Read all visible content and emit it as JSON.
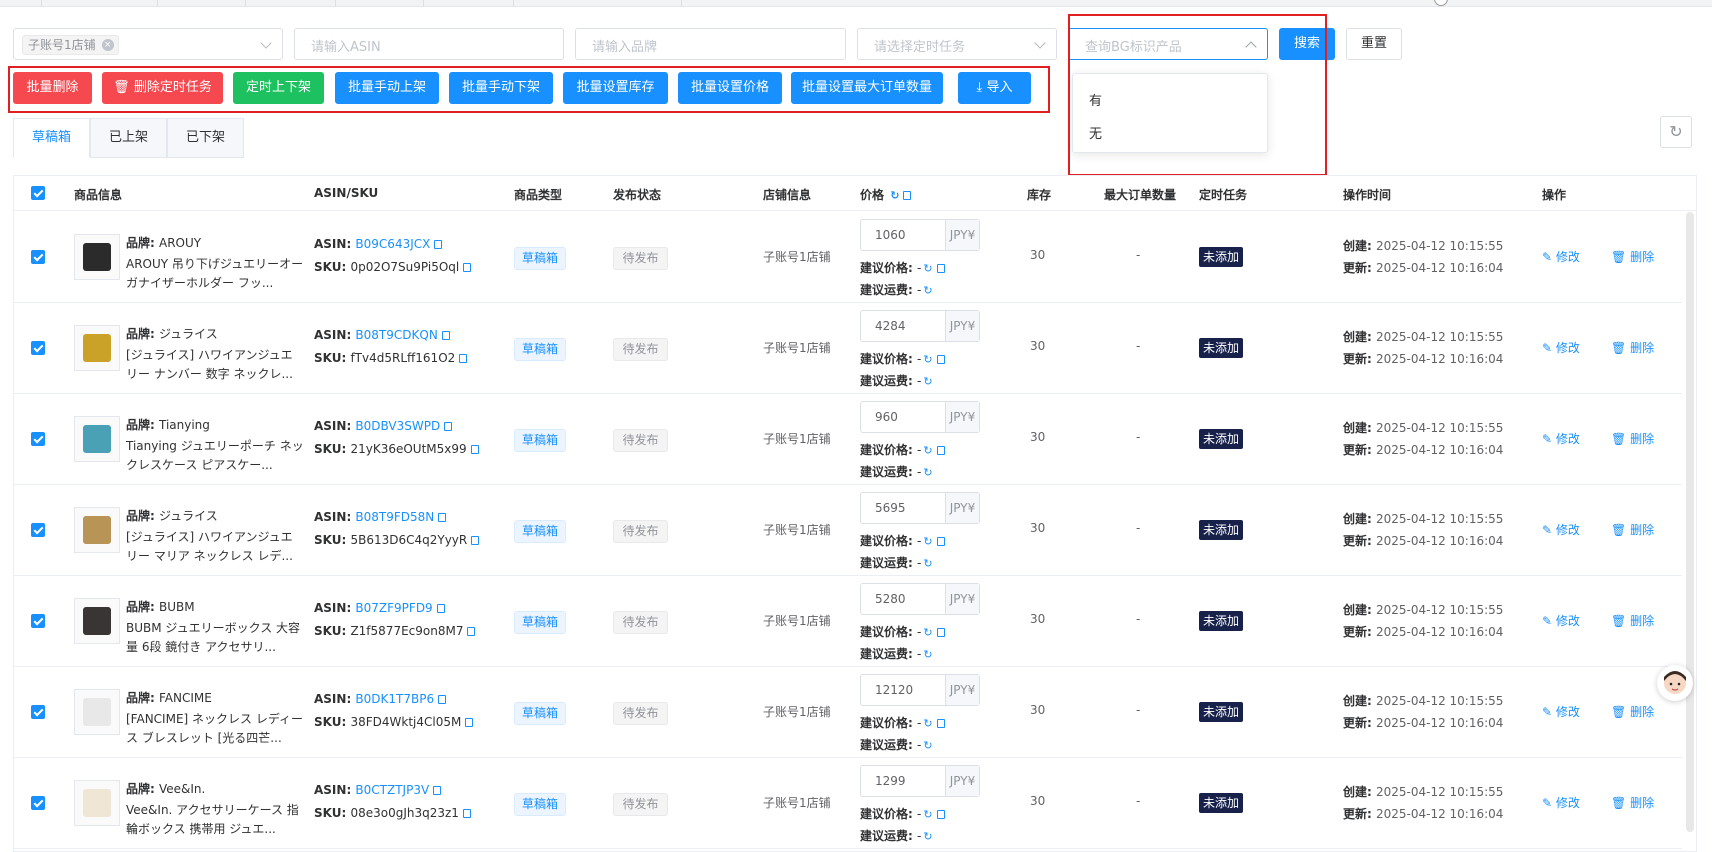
{
  "filters": {
    "store_tag": "子账号1店铺",
    "asin_placeholder": "请输入ASIN",
    "brand_placeholder": "请输入品牌",
    "task_placeholder": "请选择定时任务",
    "bg_placeholder": "查询BG标识产品",
    "search_label": "搜索",
    "reset_label": "重置"
  },
  "dropdown": {
    "options": [
      "有",
      "无"
    ]
  },
  "actions": {
    "batch_delete": "批量删除",
    "delete_timer": "删除定时任务",
    "timed_shelf": "定时上下架",
    "batch_list": "批量手动上架",
    "batch_delist": "批量手动下架",
    "batch_stock": "批量设置库存",
    "batch_price": "批量设置价格",
    "batch_max_order": "批量设置最大订单数量",
    "import": "导入"
  },
  "tabs": [
    "草稿箱",
    "已上架",
    "已下架"
  ],
  "columns": {
    "product": "商品信息",
    "asin_sku": "ASIN/SKU",
    "type": "商品类型",
    "status": "发布状态",
    "store": "店铺信息",
    "price": "价格",
    "stock": "库存",
    "max_order": "最大订单数量",
    "schedule": "定时任务",
    "op_time": "操作时间",
    "ops": "操作"
  },
  "labels": {
    "brand": "品牌: ",
    "asin": "ASIN: ",
    "sku": "SKU: ",
    "suggest_price": "建议价格: ",
    "suggest_ship": "建议运费: ",
    "created": "创建: ",
    "updated": "更新: ",
    "edit": "修改",
    "delete": "删除",
    "currency": "JPY¥",
    "dash": "-"
  },
  "rows": [
    {
      "brand": "AROUY",
      "name": "AROUY 吊り下げジュエリーオーガナイザーホルダー フッ...",
      "asin": "B09C643JCX",
      "sku": "0p02O7Su9Pi5Oql",
      "type": "草稿箱",
      "status": "待发布",
      "store": "子账号1店铺",
      "price": "1060",
      "stock": "30",
      "max_order": "-",
      "schedule": "未添加",
      "created": "2025-04-12 10:15:55",
      "updated": "2025-04-12 10:16:04"
    },
    {
      "brand": "ジュライス",
      "name": "[ジュライス] ハワイアンジュエリー ナンバー 数字 ネックレ...",
      "asin": "B08T9CDKQN",
      "sku": "fTv4d5RLff161O2",
      "type": "草稿箱",
      "status": "待发布",
      "store": "子账号1店铺",
      "price": "4284",
      "stock": "30",
      "max_order": "-",
      "schedule": "未添加",
      "created": "2025-04-12 10:15:55",
      "updated": "2025-04-12 10:16:04"
    },
    {
      "brand": "Tianying",
      "name": "Tianying ジュエリーポーチ ネックレスケース ピアスケー...",
      "asin": "B0DBV3SWPD",
      "sku": "21yK36eOUtM5x99",
      "type": "草稿箱",
      "status": "待发布",
      "store": "子账号1店铺",
      "price": "960",
      "stock": "30",
      "max_order": "-",
      "schedule": "未添加",
      "created": "2025-04-12 10:15:55",
      "updated": "2025-04-12 10:16:04"
    },
    {
      "brand": "ジュライス",
      "name": "[ジュライス] ハワイアンジュエリー マリア ネックレス レデ...",
      "asin": "B08T9FD58N",
      "sku": "5B613D6C4q2YyyR",
      "type": "草稿箱",
      "status": "待发布",
      "store": "子账号1店铺",
      "price": "5695",
      "stock": "30",
      "max_order": "-",
      "schedule": "未添加",
      "created": "2025-04-12 10:15:55",
      "updated": "2025-04-12 10:16:04"
    },
    {
      "brand": "BUBM",
      "name": "BUBM ジュエリーボックス 大容量 6段 鏡付き アクセサリ...",
      "asin": "B07ZF9PFD9",
      "sku": "Z1f5877Ec9on8M7",
      "type": "草稿箱",
      "status": "待发布",
      "store": "子账号1店铺",
      "price": "5280",
      "stock": "30",
      "max_order": "-",
      "schedule": "未添加",
      "created": "2025-04-12 10:15:55",
      "updated": "2025-04-12 10:16:04"
    },
    {
      "brand": "FANCIME",
      "name": "[FANCIME] ネックレス レディース ブレスレット [光る四芒...",
      "asin": "B0DK1T7BP6",
      "sku": "38FD4Wktj4Cl05M",
      "type": "草稿箱",
      "status": "待发布",
      "store": "子账号1店铺",
      "price": "12120",
      "stock": "30",
      "max_order": "-",
      "schedule": "未添加",
      "created": "2025-04-12 10:15:55",
      "updated": "2025-04-12 10:16:04"
    },
    {
      "brand": "Vee&In.",
      "name": "Vee&In. アクセサリーケース 指輪ボックス 携帯用 ジュエ...",
      "asin": "B0CTZTJP3V",
      "sku": "08e3o0gJh3q23z1",
      "type": "草稿箱",
      "status": "待发布",
      "store": "子账号1店铺",
      "price": "1299",
      "stock": "30",
      "max_order": "-",
      "schedule": "未添加",
      "created": "2025-04-12 10:15:55",
      "updated": "2025-04-12 10:16:04"
    }
  ]
}
